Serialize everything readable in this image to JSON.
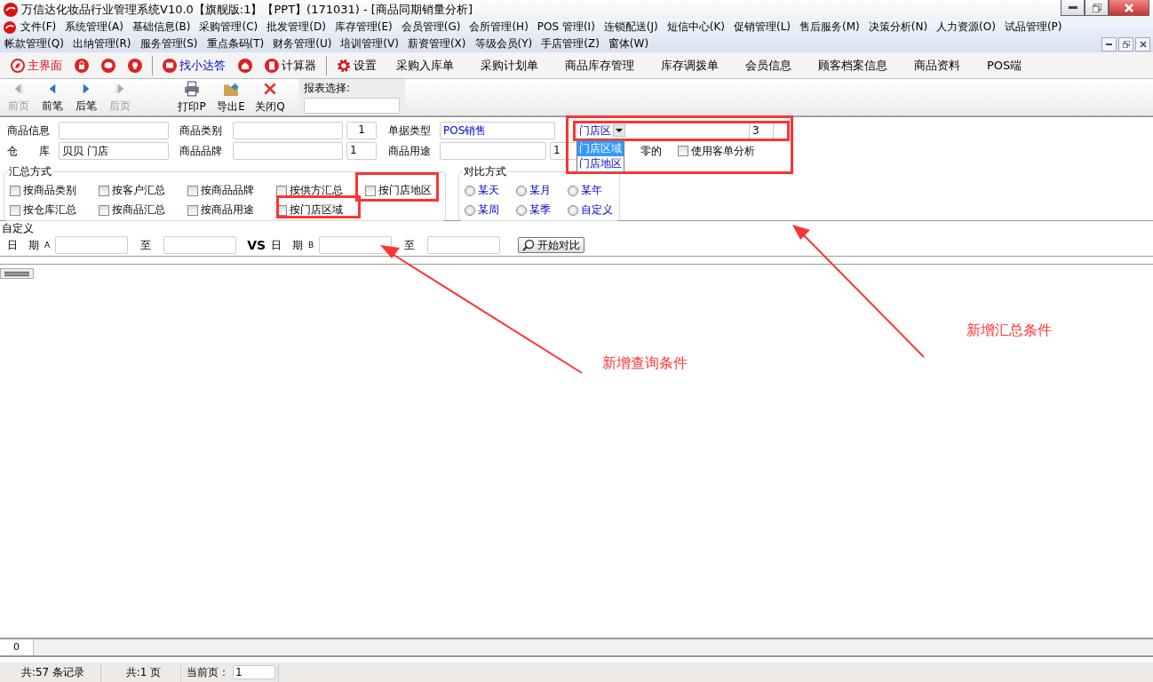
{
  "window": {
    "title": "万信达化妆品行业管理系统V10.0【旗舰版:1】【PPT】(171031) - [商品同期销量分析]"
  },
  "menu_rows": [
    [
      "文件(F)",
      "系统管理(A)",
      "基础信息(B)",
      "采购管理(C)",
      "批发管理(D)",
      "库存管理(E)",
      "会员管理(G)",
      "会所管理(H)",
      "POS 管理(I)",
      "连锁配送(J)",
      "短信中心(K)",
      "促销管理(L)",
      "售后服务(M)",
      "决策分析(N)",
      "人力资源(O)",
      "试品管理(P)"
    ],
    [
      "帐款管理(Q)",
      "出纳管理(R)",
      "服务管理(S)",
      "重点条码(T)",
      "财务管理(U)",
      "培训管理(V)",
      "薪资管理(X)",
      "等级会员(Y)",
      "手店管理(Z)",
      "窗体(W)"
    ]
  ],
  "toolbar": [
    {
      "kind": "home",
      "label": "主界面"
    },
    {
      "kind": "lock"
    },
    {
      "kind": "chat"
    },
    {
      "kind": "bulb"
    },
    {
      "kind": "sep"
    },
    {
      "kind": "help",
      "label": "找小达答"
    },
    {
      "kind": "house"
    },
    {
      "kind": "calc",
      "label": "计算器"
    },
    {
      "kind": "sep"
    },
    {
      "kind": "gear",
      "label": "设置"
    },
    {
      "kind": "text",
      "label": "采购入库单"
    },
    {
      "kind": "text",
      "label": "采购计划单"
    },
    {
      "kind": "text",
      "label": "商品库存管理"
    },
    {
      "kind": "text",
      "label": "库存调拨单"
    },
    {
      "kind": "text",
      "label": "会员信息"
    },
    {
      "kind": "text",
      "label": "顾客档案信息"
    },
    {
      "kind": "text",
      "label": "商品资料"
    },
    {
      "kind": "text",
      "label": "POS端"
    }
  ],
  "nav_buttons": [
    {
      "kind": "first",
      "label": "前页",
      "disabled": true
    },
    {
      "kind": "prev",
      "label": "前笔",
      "disabled": false
    },
    {
      "kind": "next",
      "label": "后笔",
      "disabled": false
    },
    {
      "kind": "last",
      "label": "后页",
      "disabled": true
    }
  ],
  "action_buttons": [
    {
      "kind": "print",
      "label": "打印P"
    },
    {
      "kind": "export",
      "label": "导出E"
    },
    {
      "kind": "close",
      "label": "关闭Q"
    }
  ],
  "report_select": {
    "label": "报表选择:"
  },
  "filters": {
    "goods_info": {
      "label": "商品信息"
    },
    "category": {
      "label": "商品类别",
      "count": "1"
    },
    "doc_type": {
      "label": "单据类型",
      "value": "POS销售"
    },
    "warehouse": {
      "label": "仓　　库",
      "value": "贝贝 门店"
    },
    "brand": {
      "label": "商品品牌",
      "count": "1"
    },
    "usage": {
      "label": "商品用途",
      "count": "1"
    },
    "region_select": {
      "value": "门店区",
      "count": "3",
      "options": [
        {
          "label": "门店区域",
          "selected": true
        },
        {
          "label": "门店地区",
          "selected": false
        }
      ]
    },
    "zero_label": "零的",
    "customer_analysis": {
      "label": "使用客单分析",
      "checked": false
    }
  },
  "summary": {
    "title": "汇总方式",
    "options": [
      {
        "label": "按商品类别",
        "checked": false
      },
      {
        "label": "按客户汇总",
        "checked": false
      },
      {
        "label": "按商品品牌",
        "checked": false
      },
      {
        "label": "按供方汇总",
        "checked": false
      },
      {
        "label": "按门店地区",
        "checked": false
      },
      {
        "label": "按仓库汇总",
        "checked": false
      },
      {
        "label": "按商品汇总",
        "checked": false
      },
      {
        "label": "按商品用途",
        "checked": false
      },
      {
        "label": "按门店区域",
        "checked": false
      }
    ]
  },
  "compare": {
    "title": "对比方式",
    "options": [
      {
        "label": "某天",
        "selected": false
      },
      {
        "label": "某月",
        "selected": false
      },
      {
        "label": "某年",
        "selected": false
      },
      {
        "label": "某周",
        "selected": false
      },
      {
        "label": "某季",
        "selected": false
      },
      {
        "label": "自定义",
        "selected": false
      }
    ]
  },
  "custom": {
    "title": "自定义",
    "date_a": "日　期",
    "a": "A",
    "to": "至",
    "vs": "VS",
    "date_b": "日　期",
    "b": "B",
    "to_b": "至",
    "start_button": "开始对比"
  },
  "grid_footer": "0",
  "status_bar": {
    "records": "共:57 条记录",
    "pages": "共:1 页",
    "current_label": "当前页：",
    "current_page": "1"
  },
  "annotations": [
    {
      "text": "新增查询条件"
    },
    {
      "text": "新增汇总条件"
    }
  ]
}
